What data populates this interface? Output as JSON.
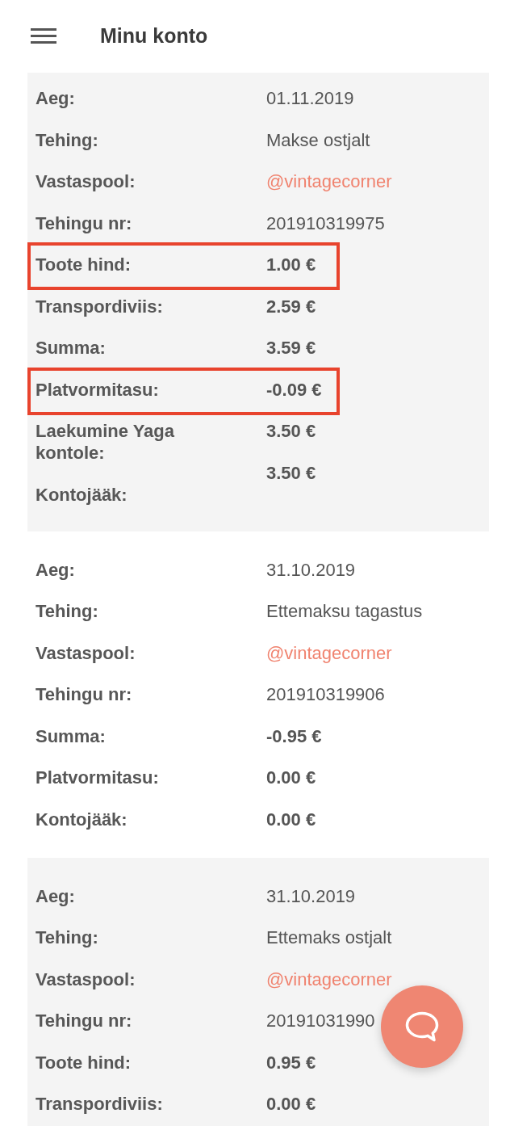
{
  "header": {
    "title": "Minu konto"
  },
  "transactions": [
    {
      "rows": [
        {
          "label": "Aeg:",
          "value": "01.11.2019",
          "kind": "text",
          "highlighted": false
        },
        {
          "label": "Tehing:",
          "value": "Makse ostjalt",
          "kind": "text",
          "highlighted": false
        },
        {
          "label": "Vastaspool:",
          "value": "@vintagecorner",
          "kind": "link",
          "highlighted": false
        },
        {
          "label": "Tehingu nr:",
          "value": "201910319975",
          "kind": "text",
          "highlighted": false
        },
        {
          "label": "Toote hind:",
          "value": "1.00 €",
          "kind": "amount",
          "highlighted": true
        },
        {
          "label": "Transpordiviis:",
          "value": "2.59 €",
          "kind": "amount",
          "highlighted": false
        },
        {
          "label": "Summa:",
          "value": "3.59 €",
          "kind": "amount",
          "highlighted": false
        },
        {
          "label": "Platvormitasu:",
          "value": "-0.09 €",
          "kind": "amount",
          "highlighted": true
        },
        {
          "label": "Laekumine Yaga kontole:",
          "value": "3.50 €",
          "kind": "amount",
          "highlighted": false
        },
        {
          "label": "Kontojääk:",
          "value": "3.50 €",
          "kind": "amount",
          "highlighted": false
        }
      ]
    },
    {
      "rows": [
        {
          "label": "Aeg:",
          "value": "31.10.2019",
          "kind": "text",
          "highlighted": false
        },
        {
          "label": "Tehing:",
          "value": "Ettemaksu tagastus",
          "kind": "text",
          "highlighted": false
        },
        {
          "label": "Vastaspool:",
          "value": "@vintagecorner",
          "kind": "link",
          "highlighted": false
        },
        {
          "label": "Tehingu nr:",
          "value": "201910319906",
          "kind": "text",
          "highlighted": false
        },
        {
          "label": "Summa:",
          "value": "-0.95 €",
          "kind": "amount",
          "highlighted": false
        },
        {
          "label": "Platvormitasu:",
          "value": "0.00 €",
          "kind": "amount",
          "highlighted": false
        },
        {
          "label": "Kontojääk:",
          "value": "0.00 €",
          "kind": "amount",
          "highlighted": false
        }
      ]
    },
    {
      "rows": [
        {
          "label": "Aeg:",
          "value": "31.10.2019",
          "kind": "text",
          "highlighted": false
        },
        {
          "label": "Tehing:",
          "value": "Ettemaks ostjalt",
          "kind": "text",
          "highlighted": false
        },
        {
          "label": "Vastaspool:",
          "value": "@vintagecorner",
          "kind": "link",
          "highlighted": false
        },
        {
          "label": "Tehingu nr:",
          "value": "20191031990",
          "kind": "text",
          "highlighted": false
        },
        {
          "label": "Toote hind:",
          "value": "0.95 €",
          "kind": "amount",
          "highlighted": false
        },
        {
          "label": "Transpordiviis:",
          "value": "0.00 €",
          "kind": "amount",
          "highlighted": false
        }
      ]
    }
  ]
}
